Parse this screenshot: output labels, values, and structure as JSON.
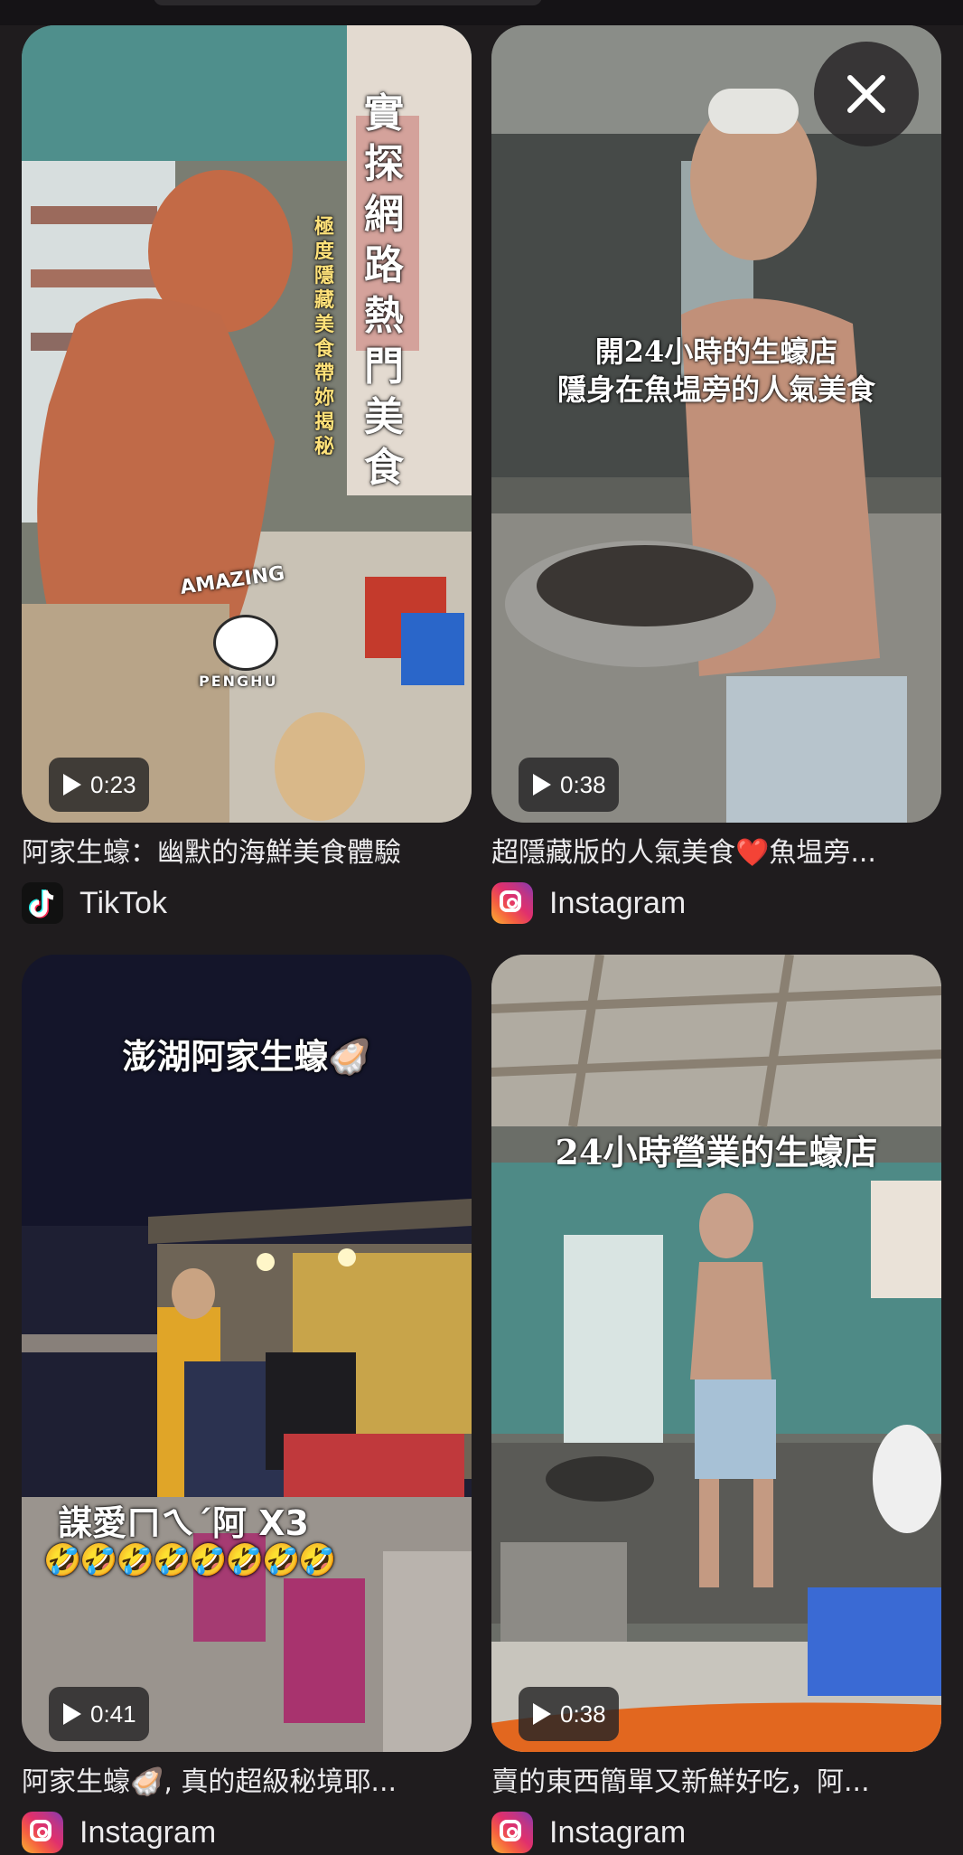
{
  "results": [
    {
      "title": "阿家生蠔：幽默的海鮮美食體驗",
      "source": "TikTok",
      "duration": "0:23",
      "overlay": {
        "vertical_main": "實探網路熱門美食",
        "vertical_sub": "極度隱藏美食 帶妳揭秘",
        "sticker_top": "AMAZING",
        "sticker_bottom": "PENGHU"
      }
    },
    {
      "title": "超隱藏版的人氣美食❤️魚塭旁...",
      "source": "Instagram",
      "duration": "0:38",
      "overlay": {
        "line1": "開24小時的生蠔店",
        "line2": "隱身在魚塭旁的人氣美食"
      }
    },
    {
      "title": "阿家生蠔🦪, 真的超級秘境耶...",
      "source": "Instagram",
      "duration": "0:41",
      "overlay": {
        "line1": "澎湖阿家生蠔🦪",
        "line2": "謀愛ㄇㄟˊ阿 X3",
        "emoji": "🤣🤣🤣🤣🤣🤣🤣🤣"
      }
    },
    {
      "title": "賣的東西簡單又新鮮好吃，阿...",
      "source": "Instagram",
      "duration": "0:38",
      "overlay": {
        "line1": "24小時營業的生蠔店"
      }
    }
  ],
  "colors": {
    "background": "#1f1c1e",
    "text": "#ecebed"
  },
  "icons": {
    "close": "close-icon",
    "play": "play-icon",
    "tiktok": "tiktok-icon",
    "instagram": "instagram-icon"
  }
}
